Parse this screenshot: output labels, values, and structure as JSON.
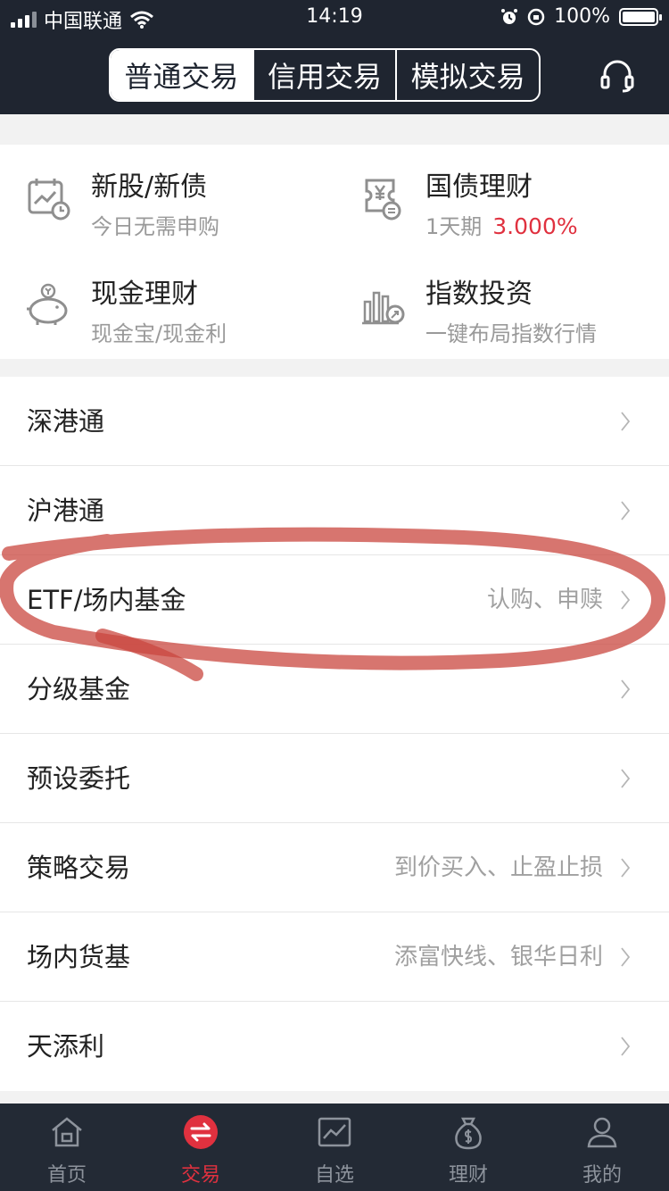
{
  "status_bar": {
    "carrier": "中国联通",
    "time": "14:19",
    "battery": "100%"
  },
  "header": {
    "tabs": [
      {
        "label": "普通交易"
      },
      {
        "label": "信用交易"
      },
      {
        "label": "模拟交易"
      }
    ],
    "service_icon": "headset-icon"
  },
  "features": [
    {
      "title": "新股/新债",
      "sub": "今日无需申购",
      "icon": "calendar-chart-icon"
    },
    {
      "title": "国债理财",
      "sub": "1天期",
      "rate": "3.000%",
      "icon": "yuan-ticket-icon"
    },
    {
      "title": "现金理财",
      "sub": "现金宝/现金利",
      "icon": "piggy-bank-icon"
    },
    {
      "title": "指数投资",
      "sub": "一键布局指数行情",
      "icon": "bar-chart-icon"
    }
  ],
  "list": [
    {
      "label": "深港通",
      "hint": ""
    },
    {
      "label": "沪港通",
      "hint": ""
    },
    {
      "label": "ETF/场内基金",
      "hint": "认购、申赎"
    },
    {
      "label": "分级基金",
      "hint": ""
    },
    {
      "label": "预设委托",
      "hint": ""
    },
    {
      "label": "策略交易",
      "hint": "到价买入、止盈止损"
    },
    {
      "label": "场内货基",
      "hint": "添富快线、银华日利"
    },
    {
      "label": "天添利",
      "hint": ""
    }
  ],
  "bottom_nav": [
    {
      "label": "首页",
      "icon": "home-icon"
    },
    {
      "label": "交易",
      "icon": "transfer-icon",
      "active": true
    },
    {
      "label": "自选",
      "icon": "stock-chart-icon"
    },
    {
      "label": "理财",
      "icon": "money-bag-icon"
    },
    {
      "label": "我的",
      "icon": "user-icon"
    }
  ],
  "colors": {
    "header_bg": "#1f2530",
    "accent_red": "#e0313f",
    "annotation_red": "#c9473f"
  }
}
